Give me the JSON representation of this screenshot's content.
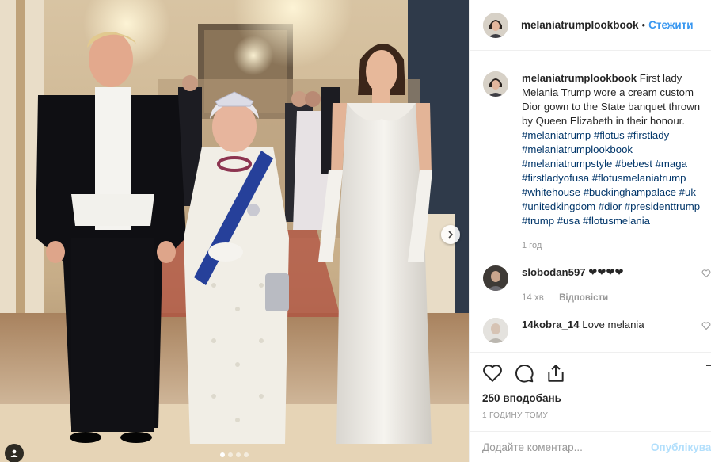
{
  "post": {
    "photo_description_icons": [
      "chevron-right-icon",
      "user-tag-icon"
    ],
    "carousel": {
      "total_slides": 4,
      "active_index": 0
    }
  },
  "header": {
    "username": "melaniatrumplookbook",
    "separator": "•",
    "follow_label": "Стежити"
  },
  "caption": {
    "username": "melaniatrumplookbook",
    "text": " First lady Melania Trump wore a cream custom Dior gown to the State banquet thrown by Queen Elizabeth in their honour. ",
    "hashtags": "#melaniatrump #flotus #firstlady #melaniatrumplookbook #melaniatrumpstyle #bebest #maga #firstladyofusa #flotusmelaniatrump #whitehouse #buckinghampalace #uk #unitedkingdom #dior #presidenttrump #trump #usa #flotusmelania",
    "time": "1 год"
  },
  "comments": [
    {
      "username": "slobodan597",
      "text": " ❤❤❤❤",
      "time": "14 хв",
      "reply_label": "Відповісти"
    },
    {
      "username": "14kobra_14",
      "text": " Love melania",
      "time": "",
      "reply_label": ""
    }
  ],
  "actions": {
    "icons": [
      "heart-icon",
      "comment-icon",
      "share-icon",
      "bookmark-icon"
    ],
    "likes": "250 вподобань",
    "post_time": "1 ГОДИНУ ТОМУ"
  },
  "add_comment": {
    "placeholder": "Додайте коментар...",
    "publish_label": "Опублікувати"
  },
  "colors": {
    "link_blue": "#3897f0",
    "hashtag": "#003569",
    "muted": "#999999",
    "border": "#efefef"
  }
}
